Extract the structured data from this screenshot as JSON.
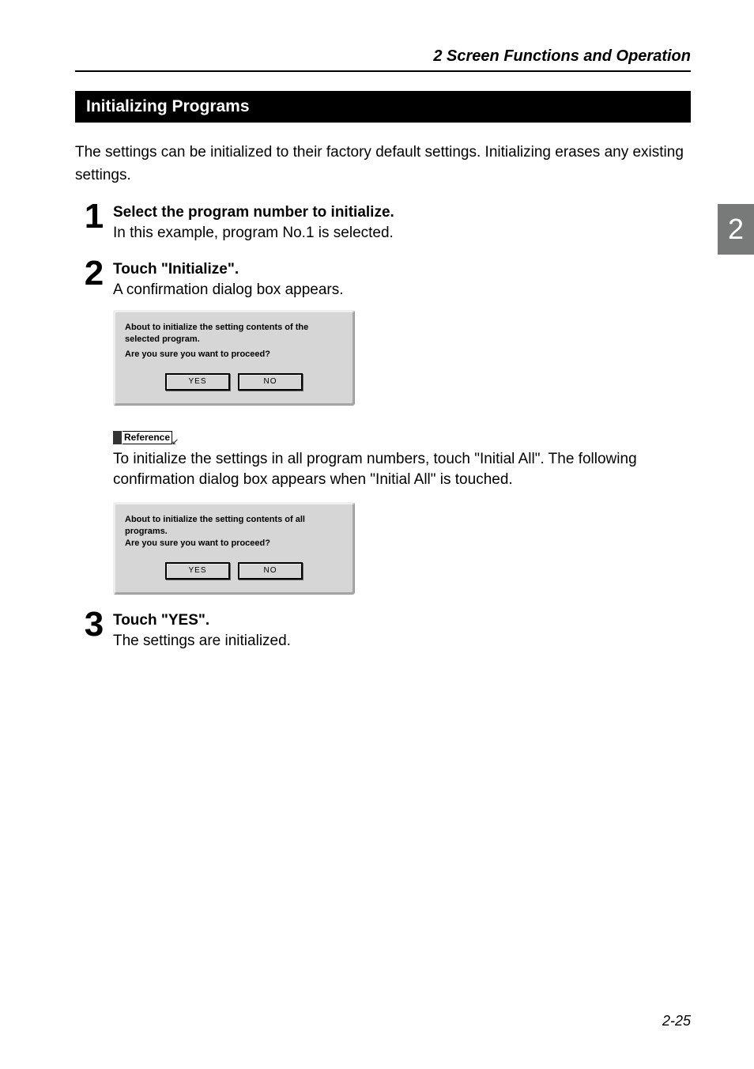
{
  "header": {
    "chapter": "2  Screen Functions and Operation"
  },
  "section_heading": "Initializing Programs",
  "intro": "The settings can be initialized to their factory default settings. Initializing erases any existing settings.",
  "steps": [
    {
      "num": "1",
      "title": "Select the program number to initialize.",
      "desc": "In this example, program No.1 is selected."
    },
    {
      "num": "2",
      "title": "Touch \"Initialize\".",
      "desc": "A confirmation dialog box appears."
    },
    {
      "num": "3",
      "title": "Touch \"YES\".",
      "desc": "The settings are initialized."
    }
  ],
  "dialog1": {
    "line1": "About to initialize the setting contents of the selected program.",
    "line2": "Are you sure you want to proceed?",
    "yes": "YES",
    "no": "NO"
  },
  "reference": {
    "label": "Reference",
    "desc": "To initialize the settings in all program numbers, touch \"Initial All\". The following confirmation dialog box appears when \"Initial All\" is touched."
  },
  "dialog2": {
    "line1": "About to initialize the setting contents of all programs.",
    "line2": "Are you sure you want to proceed?",
    "yes": "YES",
    "no": "NO"
  },
  "side_tab": "2",
  "page_number": "2-25"
}
